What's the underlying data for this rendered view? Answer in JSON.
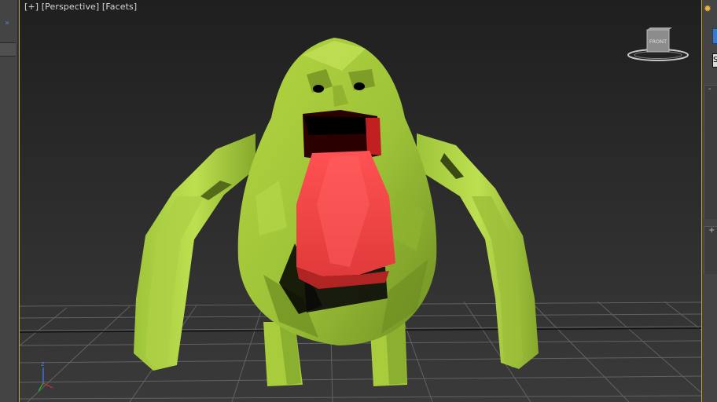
{
  "viewport": {
    "label_plus": "[+]",
    "label_view": "[Perspective]",
    "label_shading": "[Facets]",
    "viewcube_face": "FRONT",
    "axis_label": "z"
  },
  "left_panel": {
    "expand_glyph": "»"
  },
  "right_panel": {
    "sun_glyph": "✹",
    "field_value": "S",
    "rollout_mark_1": "-",
    "rollout_mark_2": "+"
  },
  "colors": {
    "viewport_border": "#c8a23a",
    "body_green": "#a6c93a",
    "tongue_red": "#e03b3b",
    "grid": "#6a6a6a"
  }
}
